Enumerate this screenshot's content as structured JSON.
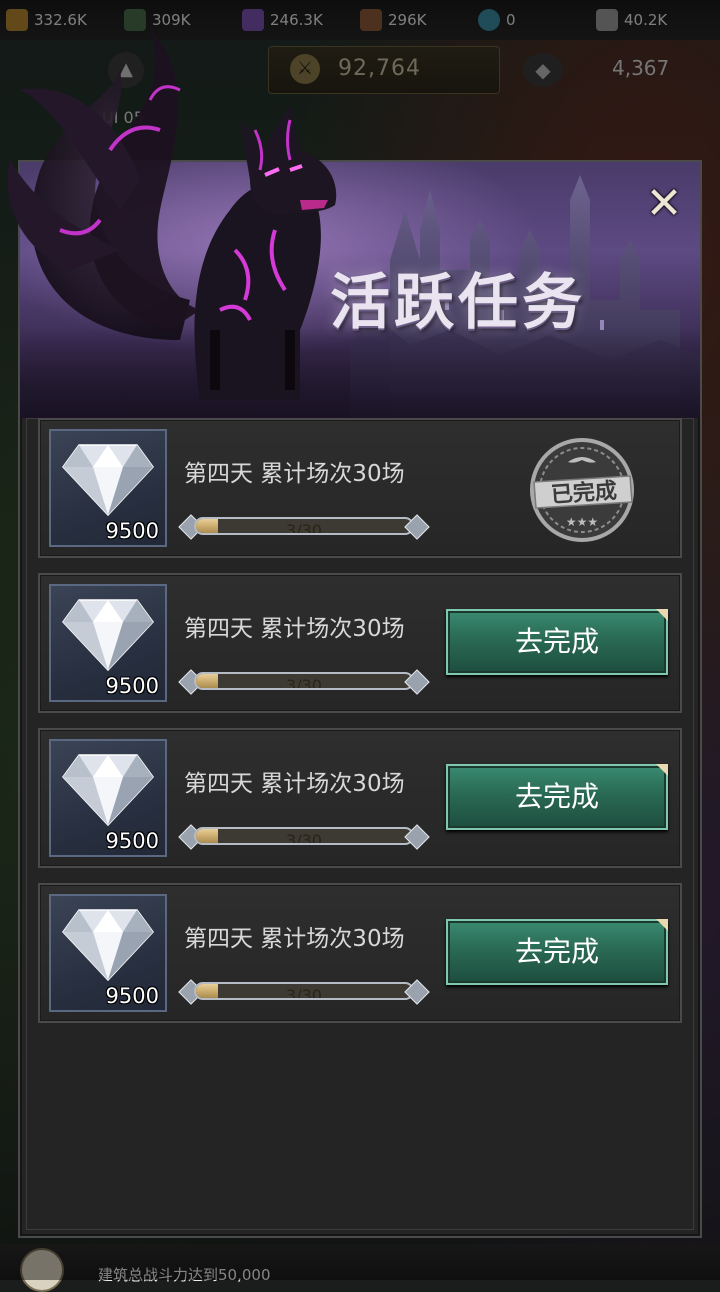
{
  "resources": [
    {
      "value": "332.6K",
      "icon": "wood-icon",
      "color": "#b5852f"
    },
    {
      "value": "309K",
      "icon": "stone-icon",
      "color": "#4a6a4a"
    },
    {
      "value": "246.3K",
      "icon": "crystal-icon",
      "color": "#7a52b0"
    },
    {
      "value": "296K",
      "icon": "ore-icon",
      "color": "#8a5a3a"
    },
    {
      "value": "0",
      "icon": "potion-icon",
      "color": "#3a8aa0"
    },
    {
      "value": "40.2K",
      "icon": "ticket-icon",
      "color": "#9a9a9a"
    }
  ],
  "status": {
    "power": "92,764",
    "gems": "4,367",
    "level_text": "UI 05"
  },
  "modal": {
    "title": "活跃任务",
    "close_symbol": "✕"
  },
  "tasks": [
    {
      "title": "第四天  累计场次30场",
      "reward_count": "9500",
      "progress_text": "3/30",
      "progress": 0.1,
      "state": "completed",
      "stamp_text": "已完成"
    },
    {
      "title": "第四天  累计场次30场",
      "reward_count": "9500",
      "progress_text": "3/30",
      "progress": 0.1,
      "state": "pending",
      "button_label": "去完成"
    },
    {
      "title": "第四天  累计场次30场",
      "reward_count": "9500",
      "progress_text": "3/30",
      "progress": 0.1,
      "state": "pending",
      "button_label": "去完成"
    },
    {
      "title": "第四天  累计场次30场",
      "reward_count": "9500",
      "progress_text": "3/30",
      "progress": 0.1,
      "state": "pending",
      "button_label": "去完成"
    }
  ],
  "bottom_task": {
    "text": "建筑总战斗力达到50,000"
  },
  "colors": {
    "accent_green": "#2a6a55",
    "progress_gold": "#c6a768",
    "modal_bg": "#242424"
  }
}
